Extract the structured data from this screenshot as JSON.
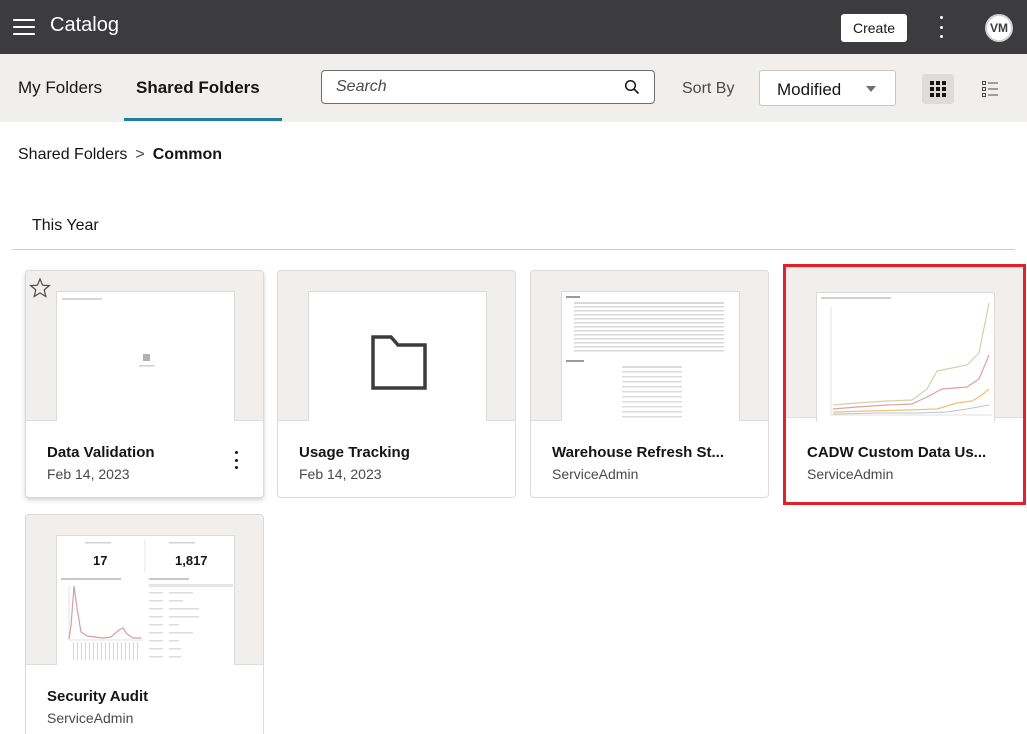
{
  "app": {
    "title": "Catalog",
    "create_label": "Create",
    "avatar_initials": "VM"
  },
  "tabs": {
    "my_folders": "My Folders",
    "shared_folders": "Shared Folders"
  },
  "search": {
    "placeholder": "Search"
  },
  "sort": {
    "label": "Sort By",
    "value": "Modified"
  },
  "breadcrumb": {
    "parent": "Shared Folders",
    "separator": ">",
    "current": "Common"
  },
  "section": {
    "title": "This Year"
  },
  "cards": [
    {
      "title": "Data Validation",
      "subtitle": "Feb 14, 2023"
    },
    {
      "title": "Usage Tracking",
      "subtitle": "Feb 14, 2023"
    },
    {
      "title": "Warehouse Refresh St...",
      "subtitle": "ServiceAdmin"
    },
    {
      "title": "CADW Custom Data Us...",
      "subtitle": "ServiceAdmin"
    },
    {
      "title": "Security Audit",
      "subtitle": "ServiceAdmin",
      "thumb_kpi_1": "17",
      "thumb_kpi_2": "1,817"
    }
  ],
  "colors": {
    "appbar": "#3c3b3d",
    "accent": "#227e9e",
    "highlight": "#e0212c",
    "toolbar": "#f1efed"
  }
}
